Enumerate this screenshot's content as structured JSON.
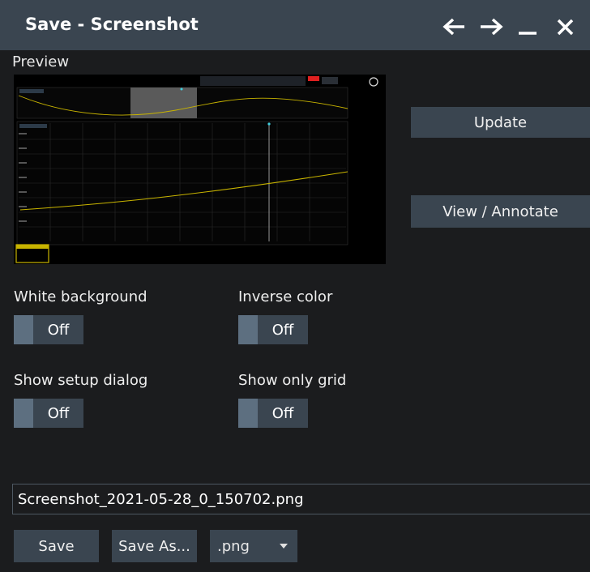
{
  "window": {
    "title": "Save - Screenshot"
  },
  "preview": {
    "label": "Preview"
  },
  "actions": {
    "update_label": "Update",
    "view_annotate_label": "View / Annotate"
  },
  "options": {
    "white_background": {
      "label": "White background",
      "state": "Off"
    },
    "inverse_color": {
      "label": "Inverse color",
      "state": "Off"
    },
    "show_setup_dialog": {
      "label": "Show setup dialog",
      "state": "Off"
    },
    "show_only_grid": {
      "label": "Show only grid",
      "state": "Off"
    }
  },
  "file": {
    "filename": "Screenshot_2021-05-28_0_150702.png"
  },
  "footer": {
    "save_label": "Save",
    "save_as_label": "Save As...",
    "format_value": ".png"
  },
  "colors": {
    "titlebar": "#3a4550",
    "background": "#1b1c1e",
    "button": "#3a4550",
    "toggle_knob": "#5d6f80",
    "trace": "#c8b400",
    "cursor_marker": "#3fd0e0",
    "preview_alarm": "#e02020"
  },
  "icons": {
    "back": "left-arrow-icon",
    "forward": "right-arrow-icon",
    "minimize": "minimize-icon",
    "close": "close-icon",
    "format_dropdown": "chevron-down-icon"
  }
}
